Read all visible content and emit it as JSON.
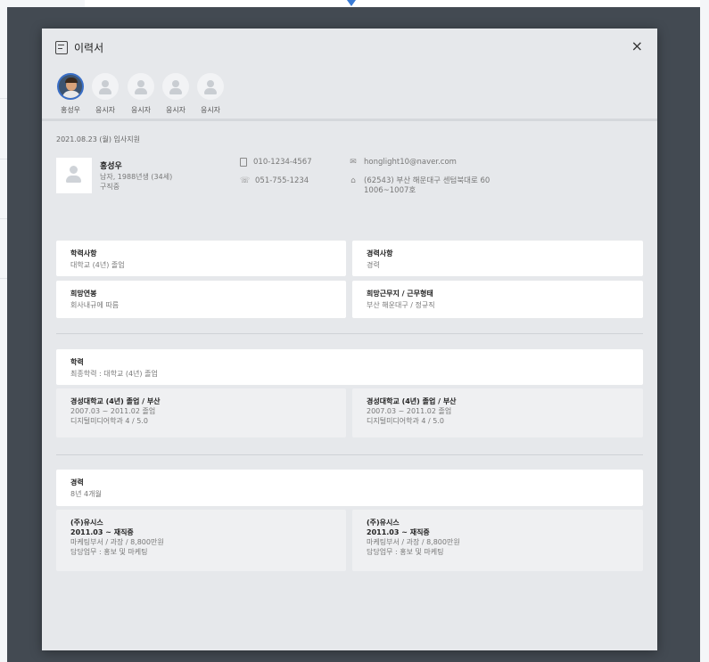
{
  "modal": {
    "title": "이력서",
    "close_label": "×"
  },
  "applicants": [
    {
      "name": "홍성우",
      "has_photo": true
    },
    {
      "name": "응시자",
      "has_photo": false
    },
    {
      "name": "응시자",
      "has_photo": false
    },
    {
      "name": "응시자",
      "has_photo": false
    },
    {
      "name": "응시자",
      "has_photo": false
    }
  ],
  "profile": {
    "date": "2021.08.23 (월) 입사지원",
    "name": "홍성우",
    "info_line1": "남자, 1988년생 (34세)",
    "info_line2": "구직중",
    "mobile": "010-1234-4567",
    "phone": "051-755-1234",
    "email": "honglight10@naver.com",
    "address_line1": "(62543) 부산 해운대구 센텀북대로 60",
    "address_line2": "1006~1007호"
  },
  "summary": {
    "education": {
      "title": "학력사항",
      "value": "대학교 (4년) 졸업"
    },
    "career": {
      "title": "경력사항",
      "value": "경력"
    },
    "salary": {
      "title": "희망연봉",
      "value": "회사내규에 따름"
    },
    "workplace": {
      "title": "희망근무지 / 근무형태",
      "value": "부산 해운대구 / 정규직"
    }
  },
  "education_section": {
    "title": "학력",
    "subtitle": "최종학력 : 대학교 (4년) 졸업",
    "items": [
      {
        "school": "경성대학교 (4년) 졸업 / 부산",
        "period": "2007.03 ~ 2011.02 졸업",
        "major": "디지털미디어학과  4 / 5.0"
      },
      {
        "school": "경성대학교 (4년) 졸업 / 부산",
        "period": "2007.03 ~ 2011.02 졸업",
        "major": "디지털미디어학과  4 / 5.0"
      }
    ]
  },
  "career_section": {
    "title": "경력",
    "subtitle": "8년 4개월",
    "items": [
      {
        "company": "(주)유시스",
        "period": "2011.03 ~ 재직중",
        "position": "마케팅부서 / 과장 / 8,800만원",
        "duty": "담당업무 : 홍보 및 마케팅"
      },
      {
        "company": "(주)유시스",
        "period": "2011.03 ~ 재직중",
        "position": "마케팅부서 / 과장 / 8,800만원",
        "duty": "담당업무 : 홍보 및 마케팅"
      }
    ]
  },
  "colors": {
    "overlay": "#434a52",
    "modal_bg": "#e6e8eb",
    "card_bg": "#ffffff",
    "accent": "#3a6fc7"
  }
}
